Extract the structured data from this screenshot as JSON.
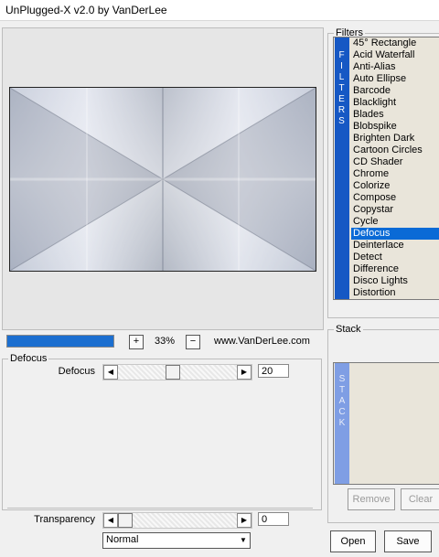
{
  "window": {
    "title": "UnPlugged-X v2.0 by VanDerLee"
  },
  "preview": {
    "progress_fraction": 1.0
  },
  "zoom": {
    "plus_label": "+",
    "minus_label": "−",
    "value": "33%"
  },
  "website": "www.VanDerLee.com",
  "params": {
    "group_label": "Defocus",
    "defocus": {
      "label": "Defocus",
      "value": "20",
      "slider_fraction": 0.45
    },
    "transparency": {
      "label": "Transparency",
      "value": "0",
      "slider_fraction": 0.0
    },
    "blend_mode": "Normal"
  },
  "filters": {
    "group_label": "Filters",
    "strip_letters": [
      "F",
      "I",
      "L",
      "T",
      "E",
      "R",
      "S"
    ],
    "items": [
      "45° Rectangle",
      "Acid Waterfall",
      "Anti-Alias",
      "Auto Ellipse",
      "Barcode",
      "Blacklight",
      "Blades",
      "Blobspike",
      "Brighten Dark",
      "Cartoon Circles",
      "CD Shader",
      "Chrome",
      "Colorize",
      "Compose",
      "Copystar",
      "Cycle",
      "Defocus",
      "Deinterlace",
      "Detect",
      "Difference",
      "Disco Lights",
      "Distortion"
    ],
    "selected": "Defocus"
  },
  "stack": {
    "group_label": "Stack",
    "strip_letters": [
      "S",
      "T",
      "A",
      "C",
      "K"
    ],
    "remove_label": "Remove",
    "clear_label": "Clear"
  },
  "buttons": {
    "open_label": "Open",
    "save_label": "Save"
  },
  "colors": {
    "accent": "#0a6ad6",
    "progress": "#1c6fd0",
    "strip": "#1658c4"
  }
}
